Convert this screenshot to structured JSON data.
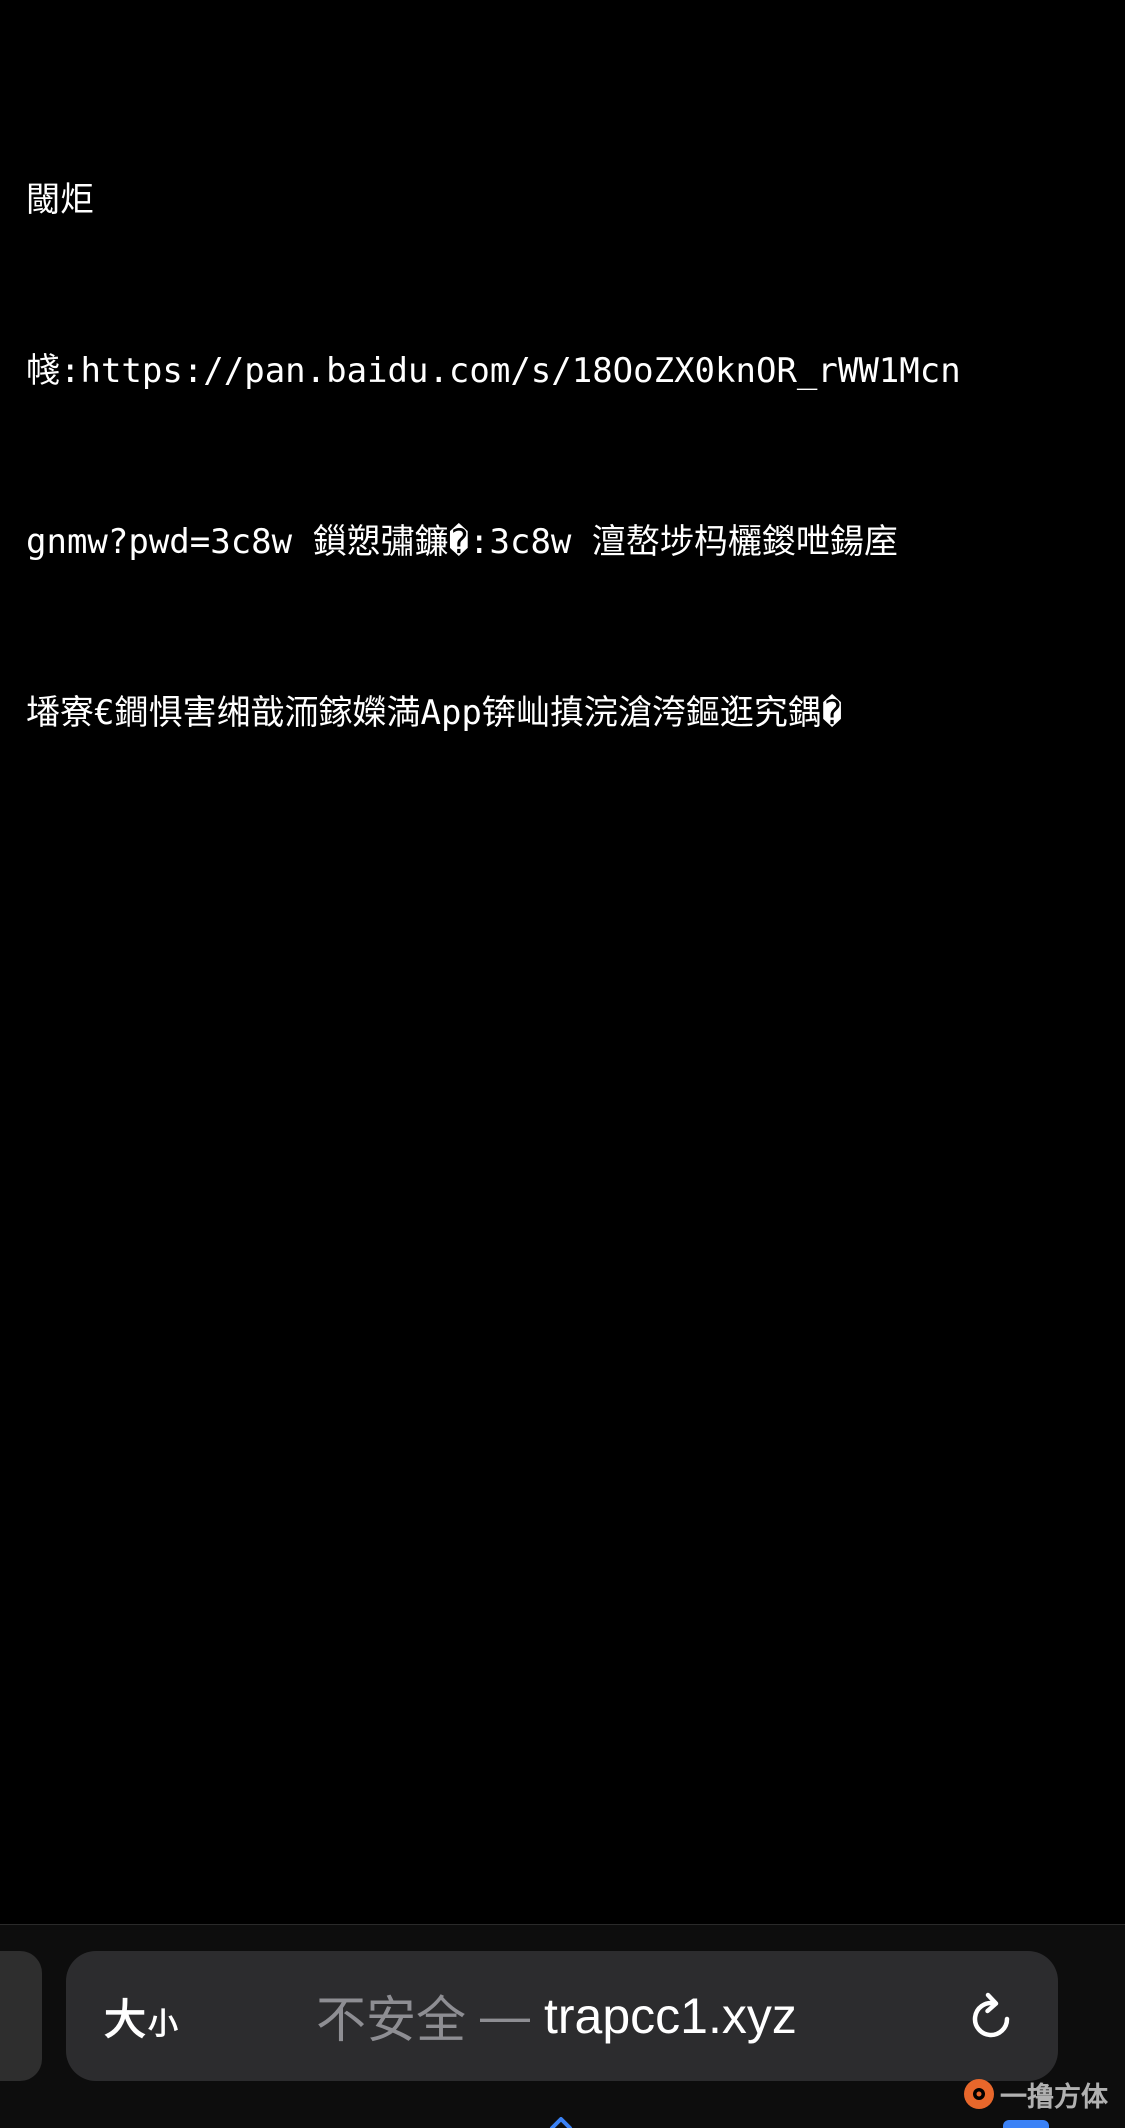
{
  "page": {
    "lines": [
      "閾炬",
      "帴:https://pan.baidu.com/s/18OoZX0knOR_rWW1Mcn",
      "gnmw?pwd=3c8w 鎻愬彇鐮�:3c8w 澶嶅埗杩欐鍐呭鍚庢",
      "墦寮€鐧惧害缃戠洏鎵嬫満App锛屾搷浣滄洿鏂逛究鍝�"
    ]
  },
  "address_bar": {
    "text_size_big": "大",
    "text_size_small": "小",
    "security_label": "不安全",
    "separator": "—",
    "domain": "trapcc1.xyz",
    "reload_icon": "reload-icon"
  },
  "watermark": {
    "text": "一撸方体",
    "logo_icon": "watermark-logo-icon"
  },
  "colors": {
    "background": "#000000",
    "text": "#ffffff",
    "address_bar": "#2c2c2e",
    "muted": "#8e8e93",
    "accent": "#3b82f6"
  }
}
